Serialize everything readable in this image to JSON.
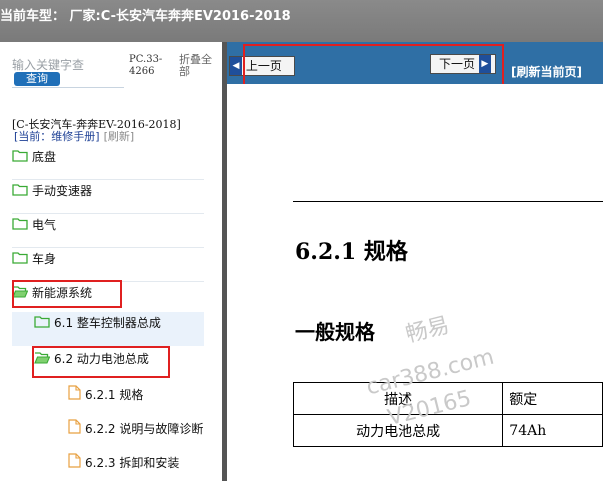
{
  "window": {
    "title": "当前车型： 厂家:C-长安汽车奔奔EV2016-2018"
  },
  "sidebar": {
    "search_placeholder": "输入关键字查",
    "search_button": "查询",
    "pc_code": "PC.33-4266",
    "collapse_all": "折叠全部",
    "vehicle_path": "[C-长安汽车-奔奔EV-2016-2018]",
    "current_label": "[当前：维修手册]",
    "refresh_label": "[刷新]",
    "tree": [
      {
        "label": "底盘",
        "type": "folder"
      },
      {
        "label": "手动变速器",
        "type": "folder"
      },
      {
        "label": "电气",
        "type": "folder"
      },
      {
        "label": "车身",
        "type": "folder"
      },
      {
        "label": "新能源系统",
        "type": "folder-open",
        "highlighted": true
      },
      {
        "label": "6.1 整车控制器总成",
        "type": "folder",
        "selected": true
      },
      {
        "label": "6.2 动力电池总成",
        "type": "folder-open",
        "highlighted": true
      },
      {
        "label": "6.2.1 规格",
        "type": "page"
      },
      {
        "label": "6.2.2 说明与故障诊断",
        "type": "page"
      },
      {
        "label": "6.2.3 拆卸和安装",
        "type": "page"
      }
    ]
  },
  "toolbar": {
    "prev_label": "上一页",
    "next_label": "下一页",
    "refresh_label": "[刷新当前页]"
  },
  "document": {
    "section_title": "6.2.1 规格",
    "subsection_title": "一般规格",
    "table": {
      "headers": [
        "描述",
        "额定"
      ],
      "rows": [
        [
          "动力电池总成",
          "74Ah"
        ]
      ]
    }
  },
  "watermark": {
    "line1": "畅易",
    "line2": "car388.com",
    "line3": "V20165"
  },
  "colors": {
    "highlight": "#e02020",
    "toolbar": "#2f6fa5",
    "link": "#1f6fb8",
    "folder": "#3aaa35",
    "page": "#e8a040"
  }
}
